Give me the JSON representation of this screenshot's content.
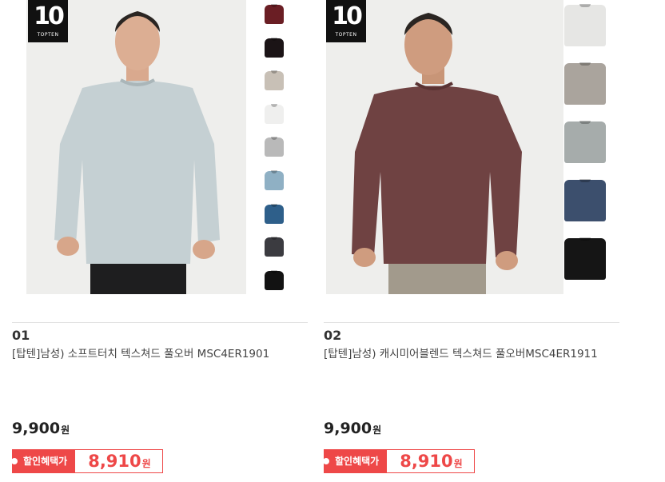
{
  "products": [
    {
      "rank": "01",
      "name": "[탑텐]남성) 소프트터치 텍스쳐드 풀오버 MSC4ER1901",
      "price": "9,900",
      "currency": "원",
      "deal_label": "할인혜택가",
      "deal_price": "8,910",
      "logo_number": "10",
      "logo_text": "TOPTEN",
      "main_color": "#c5d0d3",
      "swatches": [
        "#6a1e24",
        "#1b1416",
        "#c8c0b6",
        "#efefee",
        "#b9b9b9",
        "#8fb0c4",
        "#2e5f8a",
        "#3b3b40",
        "#121212"
      ]
    },
    {
      "rank": "02",
      "name": "[탑텐]남성) 캐시미어블렌드 텍스쳐드 풀오버MSC4ER1911",
      "price": "9,900",
      "currency": "원",
      "deal_label": "할인혜택가",
      "deal_price": "8,910",
      "logo_number": "10",
      "logo_text": "TOPTEN",
      "main_color": "#6f4242",
      "swatches": [
        "#e6e6e4",
        "#aaa49d",
        "#a6acab",
        "#3c4f6d",
        "#151515"
      ]
    }
  ]
}
